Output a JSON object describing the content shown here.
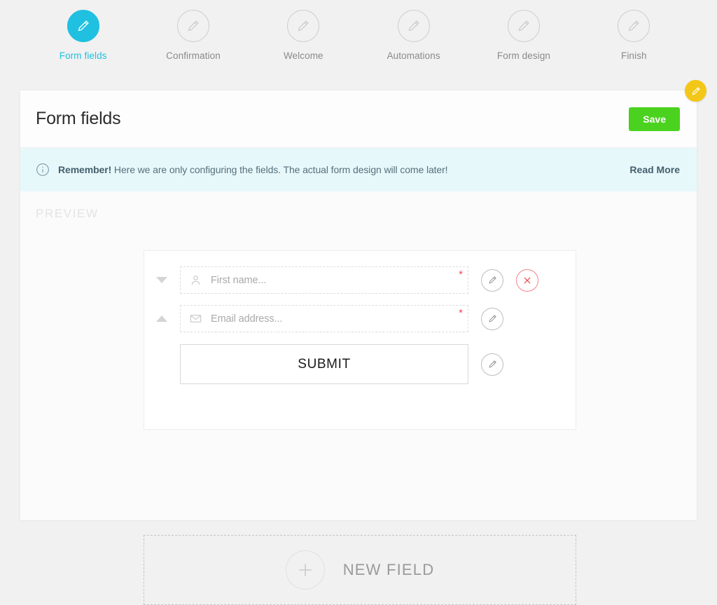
{
  "stepper": {
    "steps": [
      {
        "label": "Form fields",
        "icon": "pencil-icon",
        "active": true
      },
      {
        "label": "Confirmation",
        "icon": "pencil-icon",
        "active": false
      },
      {
        "label": "Welcome",
        "icon": "pencil-icon",
        "active": false
      },
      {
        "label": "Automations",
        "icon": "pencil-icon",
        "active": false
      },
      {
        "label": "Form design",
        "icon": "pencil-icon",
        "active": false
      },
      {
        "label": "Finish",
        "icon": "pencil-icon",
        "active": false
      }
    ],
    "active_color": "#1fc0e0",
    "inactive_color": "#8a8a8a"
  },
  "card": {
    "title": "Form fields",
    "save_label": "Save",
    "save_color": "#4ad21f",
    "fab_icon": "pencil-icon",
    "fab_color": "#f3c717"
  },
  "banner": {
    "icon": "info-circle-icon",
    "bold_text": "Remember!",
    "text": " Here we are only configuring the fields. The actual form design will come later!",
    "read_more_label": "Read More",
    "background": "#e7f8fb"
  },
  "preview": {
    "label": "PREVIEW",
    "fields": [
      {
        "placeholder": "First name...",
        "icon": "user-icon",
        "required_marker": "*",
        "sort_arrow": "triangle-down-icon",
        "edit_icon": "pencil-icon",
        "delete_icon": "close-x-icon"
      },
      {
        "placeholder": "Email address...",
        "icon": "envelope-icon",
        "required_marker": "*",
        "sort_arrow": "triangle-up-icon",
        "edit_icon": "pencil-icon"
      }
    ],
    "submit_label": "SUBMIT",
    "submit_edit_icon": "pencil-icon",
    "new_field_label": "NEW FIELD",
    "new_field_icon": "plus-circle-icon",
    "required_color": "#f4495b"
  }
}
